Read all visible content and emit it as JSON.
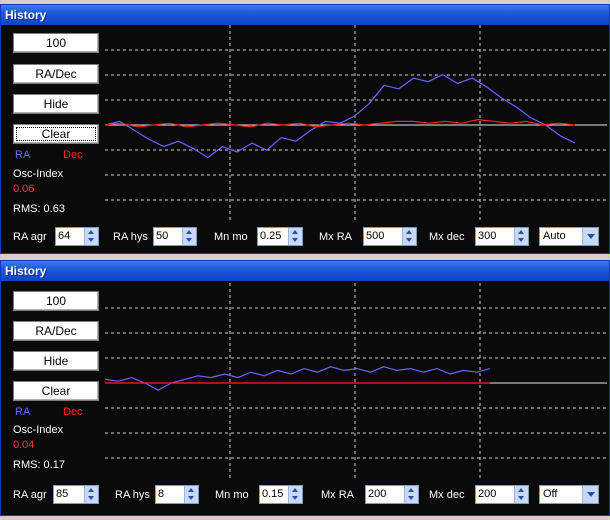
{
  "colors": {
    "ra": "#6666ff",
    "dec": "#ff2020",
    "osc": "#ff3030"
  },
  "panels": [
    {
      "title": "History",
      "buttons": {
        "scale": "100",
        "mode": "RA/Dec",
        "hide": "Hide",
        "clear": "Clear"
      },
      "legend": {
        "ra": "RA",
        "dec": "Dec"
      },
      "osc_label": "Osc-Index",
      "osc_value": "0.06",
      "rms": "RMS: 0.63",
      "controls": {
        "ra_agr_label": "RA agr",
        "ra_agr": "64",
        "ra_hys_label": "RA hys",
        "ra_hys": "50",
        "mn_mo_label": "Mn mo",
        "mn_mo": "0.25",
        "mx_ra_label": "Mx RA",
        "mx_ra": "500",
        "mx_dec_label": "Mx dec",
        "mx_dec": "300",
        "mode": "Auto"
      },
      "chart_data": {
        "type": "line",
        "series": [
          {
            "values": [
              0.0,
              0.2,
              -0.3,
              -0.8,
              -1.2,
              -0.9,
              -1.3,
              -1.8,
              -1.2,
              -1.5,
              -1.0,
              -1.4,
              -0.7,
              -0.9,
              -0.3,
              0.2,
              0.1,
              0.5,
              1.2,
              2.2,
              2.0,
              2.6,
              2.4,
              2.8,
              2.3,
              2.6,
              2.1,
              1.5,
              1.0,
              0.4,
              0.0,
              -0.6,
              -1.0
            ]
          },
          {
            "values": [
              0.0,
              0.1,
              -0.1,
              0.0,
              0.1,
              -0.1,
              0.0,
              0.1,
              0.0,
              -0.1,
              0.1,
              0.0,
              0.1,
              -0.1,
              0.0,
              0.1,
              0.0,
              0.1,
              0.2,
              0.2,
              0.1,
              0.2,
              0.1,
              0.3,
              0.2,
              0.1,
              0.2,
              0.0,
              0.1,
              0.0
            ]
          }
        ],
        "ylim": [
          -5,
          5
        ]
      }
    },
    {
      "title": "History",
      "buttons": {
        "scale": "100",
        "mode": "RA/Dec",
        "hide": "Hide",
        "clear": "Clear"
      },
      "legend": {
        "ra": "RA",
        "dec": "Dec"
      },
      "osc_label": "Osc-Index",
      "osc_value": "0.04",
      "rms": "RMS: 0.17",
      "controls": {
        "ra_agr_label": "RA agr",
        "ra_agr": "85",
        "ra_hys_label": "RA hys",
        "ra_hys": "8",
        "mn_mo_label": "Mn mo",
        "mn_mo": "0.15",
        "mx_ra_label": "Mx RA",
        "mx_ra": "200",
        "mx_dec_label": "Mx dec",
        "mx_dec": "200",
        "mode": "Off"
      },
      "chart_data": {
        "type": "line",
        "series": [
          {
            "values": [
              0.2,
              0.1,
              0.3,
              0.0,
              -0.4,
              0.0,
              0.2,
              0.4,
              0.3,
              0.5,
              0.3,
              0.6,
              0.4,
              0.7,
              0.5,
              0.8,
              0.6,
              0.9,
              0.7,
              0.8,
              0.6,
              0.9,
              0.7,
              0.8,
              0.6,
              0.8,
              0.5,
              0.7,
              0.6,
              0.8
            ]
          },
          {
            "values": [
              0.0,
              0.0,
              0.0,
              0.0,
              0.0,
              0.0,
              0.0,
              0.0,
              0.0,
              0.0,
              0.0,
              0.0,
              0.0,
              0.0,
              0.0,
              0.0,
              0.0,
              0.0,
              0.0,
              0.0,
              0.0,
              0.0,
              0.0,
              0.0,
              0.0,
              0.0,
              0.0,
              0.0,
              0.0,
              0.0
            ]
          }
        ],
        "ylim": [
          -5,
          5
        ]
      }
    }
  ]
}
